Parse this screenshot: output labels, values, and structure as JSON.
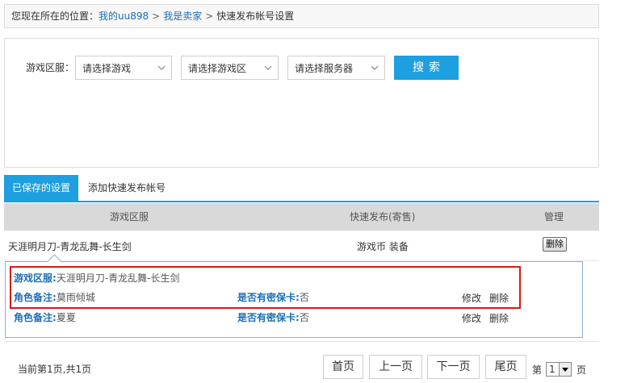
{
  "breadcrumb": {
    "prefix": "您现在所在的位置：",
    "items": [
      "我的uu898",
      "我是卖家",
      "快速发布帐号设置"
    ],
    "separator": ">"
  },
  "filter": {
    "label": "游戏区服：",
    "game_select": "请选择游戏",
    "zone_select": "请选择游戏区",
    "server_select": "请选择服务器",
    "search_label": "搜索"
  },
  "tabs": [
    {
      "label": "已保存的设置",
      "active": true
    },
    {
      "label": "添加快速发布帐号",
      "active": false
    }
  ],
  "table": {
    "headers": [
      "游戏区服",
      "快速发布(寄售)",
      "管理"
    ],
    "rows": [
      {
        "server": "天涯明月刀-青龙乱舞-长生剑",
        "publish": "游戏币 装备",
        "action": "删除"
      }
    ]
  },
  "popup": {
    "server_key": "游戏区服:",
    "server_value": "天涯明月刀-青龙乱舞-长生剑",
    "accounts": [
      {
        "role_key": "角色备注:",
        "role_value": "莫雨倾城",
        "card_key": "是否有密保卡:",
        "card_value": "否",
        "edit": "修改",
        "delete": "删除"
      },
      {
        "role_key": "角色备注:",
        "role_value": "夏夏",
        "card_key": "是否有密保卡:",
        "card_value": "否",
        "edit": "修改",
        "delete": "删除"
      }
    ]
  },
  "pager": {
    "info": "当前第1页,共1页",
    "first": "首页",
    "prev": "上一页",
    "next": "下一页",
    "last": "尾页",
    "page_prefix": "第",
    "page_value": "1",
    "page_suffix": "页"
  },
  "colors": {
    "accent": "#1e9fe0",
    "highlight": "#d41a1a",
    "link": "#1a6fb8"
  }
}
